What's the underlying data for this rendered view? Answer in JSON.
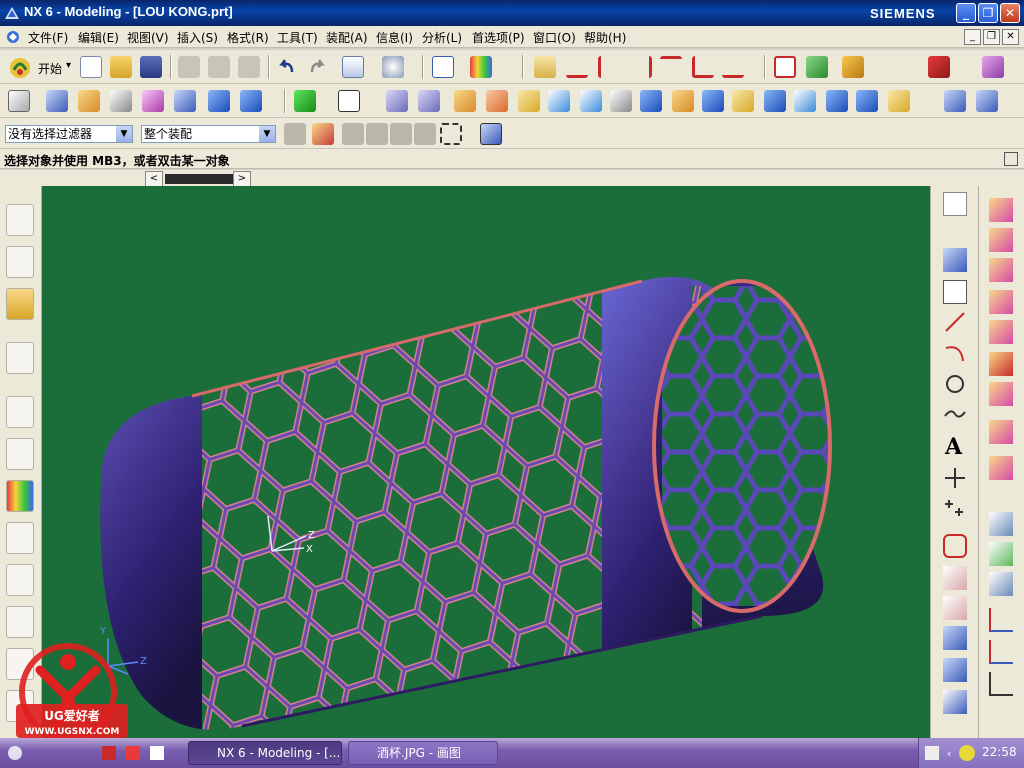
{
  "window": {
    "title": "NX 6 - Modeling - [LOU KONG.prt]",
    "brand": "SIEMENS",
    "min_label": "_",
    "max_label": "❐",
    "close_label": "✕"
  },
  "menu": {
    "items": [
      {
        "label": "文件(F)"
      },
      {
        "label": "编辑(E)"
      },
      {
        "label": "视图(V)"
      },
      {
        "label": "插入(S)"
      },
      {
        "label": "格式(R)"
      },
      {
        "label": "工具(T)"
      },
      {
        "label": "装配(A)"
      },
      {
        "label": "信息(I)"
      },
      {
        "label": "分析(L)"
      },
      {
        "label": "首选项(P)"
      },
      {
        "label": "窗口(O)"
      },
      {
        "label": "帮助(H)"
      }
    ]
  },
  "toolbar": {
    "start_label": "开始",
    "start_arrow": "▾"
  },
  "selection": {
    "filter_value": "没有选择过滤器",
    "scope_value": "整个装配",
    "arrow": "▼"
  },
  "cue": {
    "text": "选择对象并使用 MB3，或者双击某一对象"
  },
  "scroll": {
    "left": "<",
    "right": ">"
  },
  "viewport": {
    "background": "#1b6e3a",
    "part_color": "#4b3d9a",
    "edge_color": "#d86a6a",
    "axis_label_x": "X",
    "axis_label_y": "Y",
    "axis_label_z": "Z",
    "annotation": "A"
  },
  "taskbar": {
    "items": [
      {
        "label": "NX 6 - Modeling - [..."
      },
      {
        "label": "酒杯.JPG - 画图"
      }
    ],
    "clock": "22:58"
  },
  "watermark": {
    "site": "WWW.UGSNX.COM",
    "name": "UG爱好者"
  }
}
